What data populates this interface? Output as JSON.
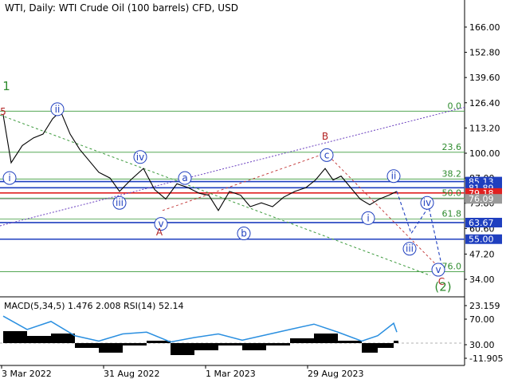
{
  "header": {
    "title": "WTI, Daily:  WTI Crude Oil (100 barrels) CFD, USD",
    "macd_label": "MACD(5,34,5) 1.476 2.008 RSI(14) 52.14"
  },
  "chart_data": {
    "type": "line",
    "title": "WTI, Daily:  WTI Crude Oil (100 barrels) CFD, USD",
    "x_labels": [
      "3 Mar 2022",
      "31 Aug 2022",
      "1 Mar 2023",
      "29 Aug 2023"
    ],
    "price_axis": {
      "ylim": [
        29,
        176
      ],
      "ticks": [
        166.0,
        152.8,
        139.6,
        126.4,
        113.2,
        100.0,
        87.0,
        73.8,
        60.6,
        47.2,
        34.0
      ],
      "tick_labels": [
        "166.00",
        "152.80",
        "139.60",
        "126.40",
        "113.20",
        "100.00",
        "87.00",
        "73.80",
        "60.60",
        "47.20",
        "34.00"
      ],
      "scale": "linear",
      "grid": false
    },
    "price_series": [
      {
        "x": 0,
        "y": 120
      },
      {
        "x": 10,
        "y": 95
      },
      {
        "x": 24,
        "y": 104
      },
      {
        "x": 38,
        "y": 108
      },
      {
        "x": 50,
        "y": 110
      },
      {
        "x": 62,
        "y": 118
      },
      {
        "x": 72,
        "y": 122
      },
      {
        "x": 84,
        "y": 110
      },
      {
        "x": 96,
        "y": 102
      },
      {
        "x": 108,
        "y": 96
      },
      {
        "x": 120,
        "y": 90
      },
      {
        "x": 134,
        "y": 87
      },
      {
        "x": 146,
        "y": 80
      },
      {
        "x": 160,
        "y": 86
      },
      {
        "x": 176,
        "y": 92
      },
      {
        "x": 190,
        "y": 81
      },
      {
        "x": 204,
        "y": 76
      },
      {
        "x": 218,
        "y": 84
      },
      {
        "x": 232,
        "y": 82
      },
      {
        "x": 246,
        "y": 79
      },
      {
        "x": 258,
        "y": 78
      },
      {
        "x": 270,
        "y": 70
      },
      {
        "x": 284,
        "y": 80
      },
      {
        "x": 298,
        "y": 78
      },
      {
        "x": 310,
        "y": 72
      },
      {
        "x": 324,
        "y": 74
      },
      {
        "x": 338,
        "y": 72
      },
      {
        "x": 352,
        "y": 77
      },
      {
        "x": 366,
        "y": 80
      },
      {
        "x": 380,
        "y": 82
      },
      {
        "x": 392,
        "y": 86
      },
      {
        "x": 404,
        "y": 92
      },
      {
        "x": 414,
        "y": 86
      },
      {
        "x": 424,
        "y": 88
      },
      {
        "x": 436,
        "y": 82
      },
      {
        "x": 448,
        "y": 76
      },
      {
        "x": 460,
        "y": 73
      },
      {
        "x": 472,
        "y": 76
      },
      {
        "x": 484,
        "y": 78
      },
      {
        "x": 494,
        "y": 80
      }
    ],
    "horizontal_levels": [
      {
        "label": "85.13",
        "value": 85.13,
        "color": "#1f3fbf"
      },
      {
        "label": "81.89",
        "value": 81.89,
        "color": "#1f3fbf"
      },
      {
        "label": "79.18",
        "value": 79.18,
        "color": "#e02020"
      },
      {
        "label": "76.09",
        "value": 76.09,
        "color": "#999999"
      },
      {
        "label": "63.67",
        "value": 63.67,
        "color": "#1f3fbf"
      },
      {
        "label": "55.00",
        "value": 55.0,
        "color": "#1f3fbf"
      }
    ],
    "fibonacci": [
      {
        "label": "0.0",
        "value": 122.0
      },
      {
        "label": "23.6",
        "value": 100.5
      },
      {
        "label": "38.2",
        "value": 86.5
      },
      {
        "label": "50.0",
        "value": 76.5
      },
      {
        "label": "61.8",
        "value": 65.5
      },
      {
        "label": "76.0",
        "value": 38.0
      }
    ],
    "wave_labels": {
      "blue": [
        "i",
        "ii",
        "iii",
        "iv",
        "v",
        "a",
        "b",
        "c",
        "i",
        "ii",
        "iii",
        "iv",
        "v"
      ],
      "red": [
        "5",
        "A",
        "B",
        "C"
      ],
      "green": [
        "1",
        "(2)"
      ]
    },
    "macd_axis": {
      "ticks": [
        23.159,
        70.0,
        30.0,
        -11.905
      ],
      "tick_labels": [
        "23.159",
        "70.00",
        "30.00",
        "-11.905"
      ]
    },
    "rsi_series": [
      {
        "x": 0,
        "y": 70
      },
      {
        "x": 30,
        "y": 55
      },
      {
        "x": 60,
        "y": 64
      },
      {
        "x": 90,
        "y": 48
      },
      {
        "x": 120,
        "y": 42
      },
      {
        "x": 150,
        "y": 50
      },
      {
        "x": 180,
        "y": 52
      },
      {
        "x": 210,
        "y": 41
      },
      {
        "x": 240,
        "y": 46
      },
      {
        "x": 270,
        "y": 50
      },
      {
        "x": 300,
        "y": 43
      },
      {
        "x": 330,
        "y": 49
      },
      {
        "x": 360,
        "y": 55
      },
      {
        "x": 390,
        "y": 61
      },
      {
        "x": 420,
        "y": 52
      },
      {
        "x": 450,
        "y": 42
      },
      {
        "x": 470,
        "y": 48
      },
      {
        "x": 490,
        "y": 62
      },
      {
        "x": 494,
        "y": 52
      }
    ],
    "macd_histogram": [
      {
        "x": 0,
        "y": 5
      },
      {
        "x": 30,
        "y": 3
      },
      {
        "x": 60,
        "y": 4
      },
      {
        "x": 90,
        "y": -2
      },
      {
        "x": 120,
        "y": -4
      },
      {
        "x": 150,
        "y": -1
      },
      {
        "x": 180,
        "y": 1
      },
      {
        "x": 210,
        "y": -5
      },
      {
        "x": 240,
        "y": -3
      },
      {
        "x": 270,
        "y": -1
      },
      {
        "x": 300,
        "y": -3
      },
      {
        "x": 330,
        "y": -1
      },
      {
        "x": 360,
        "y": 2
      },
      {
        "x": 390,
        "y": 4
      },
      {
        "x": 420,
        "y": 1
      },
      {
        "x": 450,
        "y": -4
      },
      {
        "x": 470,
        "y": -2
      },
      {
        "x": 490,
        "y": 1
      }
    ]
  }
}
